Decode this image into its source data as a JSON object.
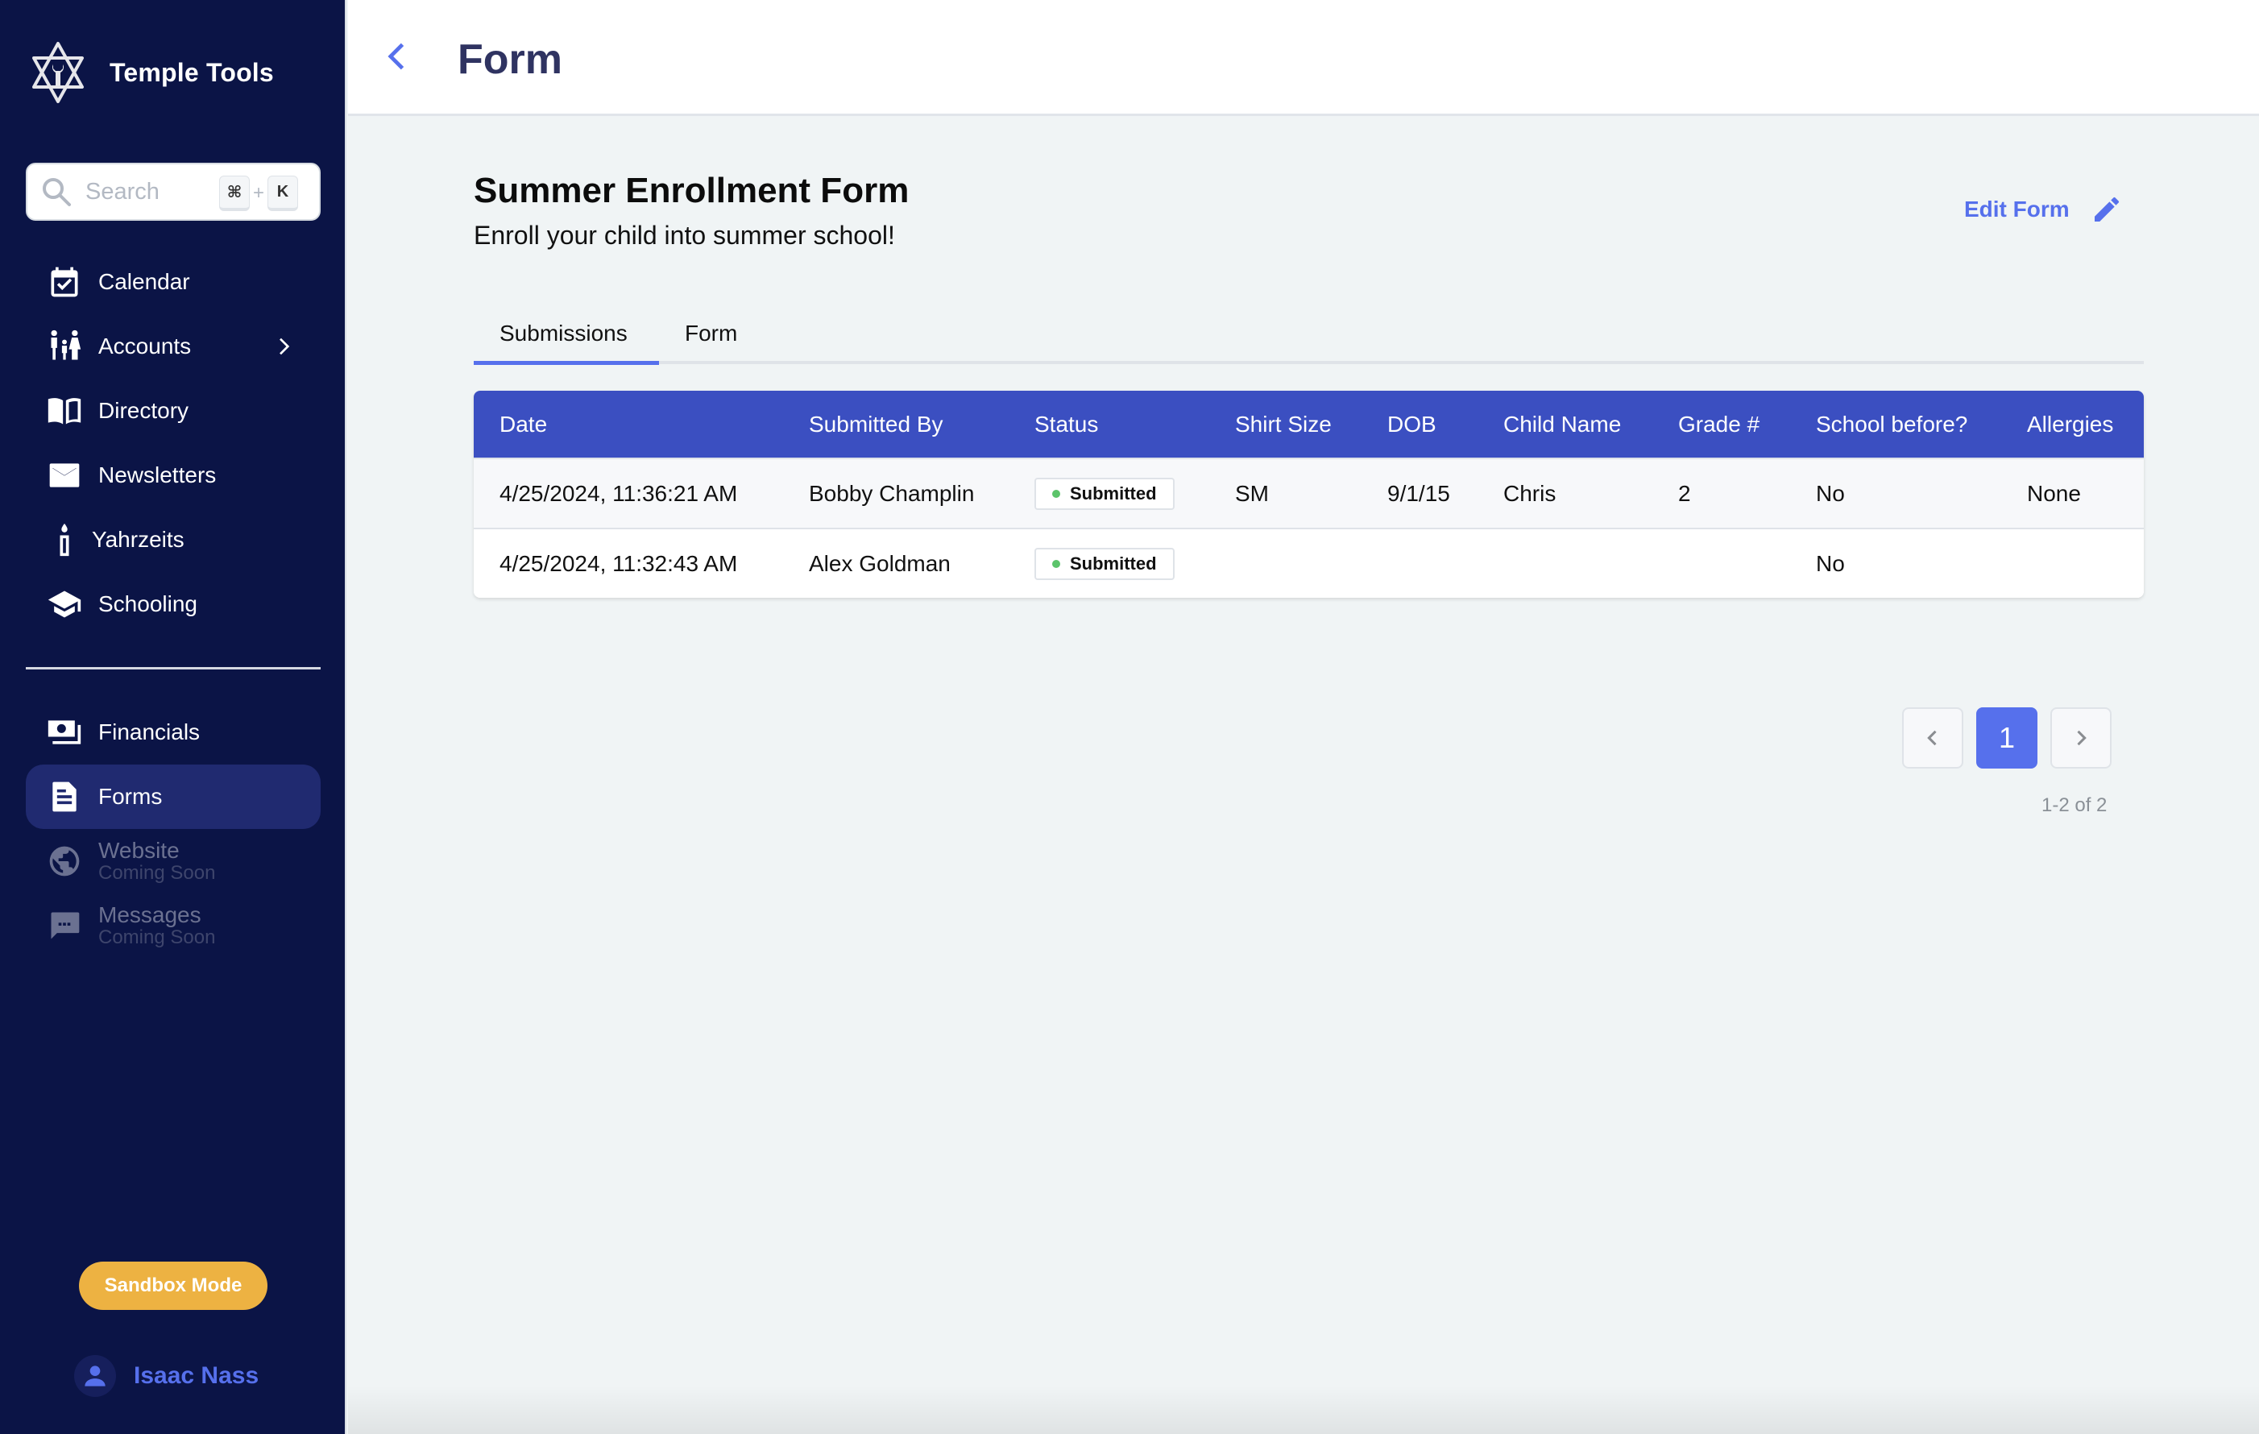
{
  "app": {
    "name": "Temple Tools",
    "logo_icon": "star-of-david-wrench-icon"
  },
  "search": {
    "placeholder": "Search",
    "value": "",
    "shortcut_modifier": "⌘",
    "shortcut_plus": "+",
    "shortcut_key": "K"
  },
  "sidebar": {
    "primary": [
      {
        "label": "Calendar",
        "icon": "calendar-check-icon"
      },
      {
        "label": "Accounts",
        "icon": "family-icon",
        "has_submenu": true
      },
      {
        "label": "Directory",
        "icon": "book-open-icon"
      },
      {
        "label": "Newsletters",
        "icon": "envelope-icon"
      },
      {
        "label": "Yahrzeits",
        "icon": "candle-icon"
      },
      {
        "label": "Schooling",
        "icon": "graduation-cap-icon"
      }
    ],
    "secondary": [
      {
        "label": "Financials",
        "icon": "money-icon"
      },
      {
        "label": "Forms",
        "icon": "document-icon",
        "active": true
      },
      {
        "label": "Website",
        "sublabel": "Coming Soon",
        "icon": "globe-icon",
        "disabled": true
      },
      {
        "label": "Messages",
        "sublabel": "Coming Soon",
        "icon": "chat-icon",
        "disabled": true
      }
    ],
    "sandbox_label": "Sandbox Mode",
    "user_name": "Isaac Nass"
  },
  "header": {
    "title": "Form"
  },
  "form": {
    "title": "Summer Enrollment Form",
    "description": "Enroll your child into summer school!",
    "edit_label": "Edit Form"
  },
  "tabs": [
    {
      "label": "Submissions",
      "active": true
    },
    {
      "label": "Form",
      "active": false
    }
  ],
  "table": {
    "columns": [
      "Date",
      "Submitted By",
      "Status",
      "Shirt Size",
      "DOB",
      "Child Name",
      "Grade #",
      "School before?",
      "Allergies"
    ],
    "rows": [
      {
        "date": "4/25/2024, 11:36:21 AM",
        "submitted_by": "Bobby Champlin",
        "status": "Submitted",
        "shirt_size": "SM",
        "dob": "9/1/15",
        "child_name": "Chris",
        "grade": "2",
        "school_before": "No",
        "allergies": "None"
      },
      {
        "date": "4/25/2024, 11:32:43 AM",
        "submitted_by": "Alex Goldman",
        "status": "Submitted",
        "shirt_size": "",
        "dob": "",
        "child_name": "",
        "grade": "",
        "school_before": "No",
        "allergies": ""
      }
    ]
  },
  "pagination": {
    "current_page": "1",
    "summary": "1-2 of 2"
  },
  "colors": {
    "sidebar_bg": "#0b1446",
    "accent": "#5670ec",
    "table_header": "#3b4fc1",
    "sandbox": "#edb242",
    "status_dot": "#5cc46b"
  }
}
